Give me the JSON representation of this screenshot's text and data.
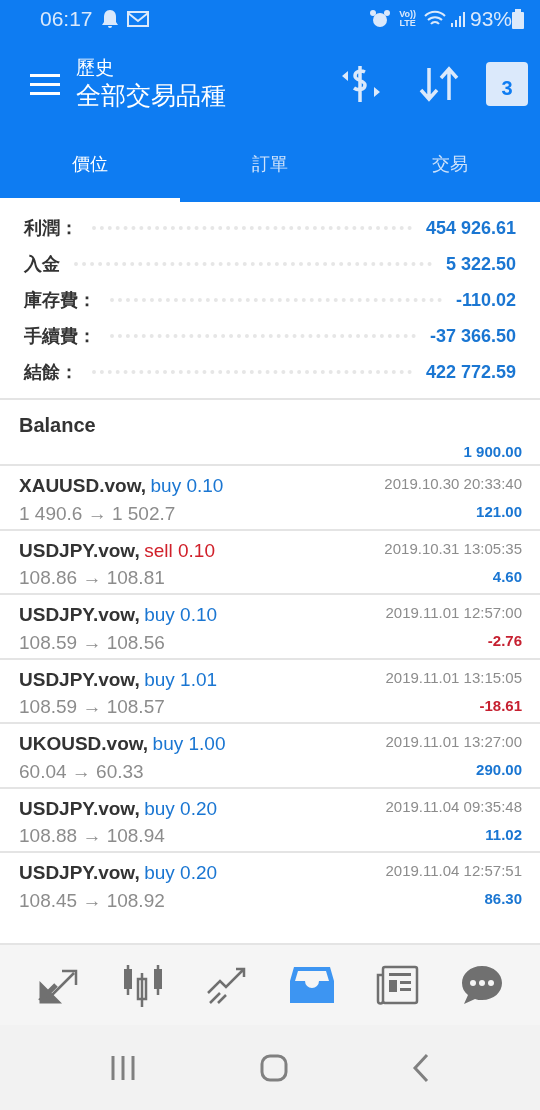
{
  "status_bar": {
    "time": "06:17",
    "volte_top": "Vo))",
    "volte_bottom": "LTE",
    "battery": "93%"
  },
  "header": {
    "subtitle": "歷史",
    "title": "全部交易品種",
    "calendar_day": "3"
  },
  "tabs": [
    {
      "label": "價位",
      "selected": true
    },
    {
      "label": "訂單",
      "selected": false
    },
    {
      "label": "交易",
      "selected": false
    }
  ],
  "summary": [
    {
      "label": "利潤：",
      "value": "454 926.61"
    },
    {
      "label": "入金",
      "value": "5 322.50"
    },
    {
      "label": "庫存費：",
      "value": "-110.02"
    },
    {
      "label": "手續費：",
      "value": "-37 366.50"
    },
    {
      "label": "結餘：",
      "value": "422 772.59"
    }
  ],
  "balance": {
    "label": "Balance",
    "amount": "1 900.00"
  },
  "trades": [
    {
      "symbol": "XAUUSD.vow,",
      "kind": "buy",
      "side": "buy 0.10",
      "prices": "1 490.6 → 1 502.7",
      "time": "2019.10.30 20:33:40",
      "profit": "121.00",
      "loss": false
    },
    {
      "symbol": "USDJPY.vow,",
      "kind": "sell",
      "side": "sell 0.10",
      "prices": "108.86 → 108.81",
      "time": "2019.10.31 13:05:35",
      "profit": "4.60",
      "loss": false
    },
    {
      "symbol": "USDJPY.vow,",
      "kind": "buy",
      "side": "buy 0.10",
      "prices": "108.59 → 108.56",
      "time": "2019.11.01 12:57:00",
      "profit": "-2.76",
      "loss": true
    },
    {
      "symbol": "USDJPY.vow,",
      "kind": "buy",
      "side": "buy 1.01",
      "prices": "108.59 → 108.57",
      "time": "2019.11.01 13:15:05",
      "profit": "-18.61",
      "loss": true
    },
    {
      "symbol": "UKOUSD.vow,",
      "kind": "buy",
      "side": "buy 1.00",
      "prices": "60.04 → 60.33",
      "time": "2019.11.01 13:27:00",
      "profit": "290.00",
      "loss": false
    },
    {
      "symbol": "USDJPY.vow,",
      "kind": "buy",
      "side": "buy 0.20",
      "prices": "108.88 → 108.94",
      "time": "2019.11.04 09:35:48",
      "profit": "11.02",
      "loss": false
    },
    {
      "symbol": "USDJPY.vow,",
      "kind": "buy",
      "side": "buy 0.20",
      "prices": "108.45 → 108.92",
      "time": "2019.11.04 12:57:51",
      "profit": "86.30",
      "loss": false
    }
  ],
  "bottom_nav": [
    {
      "kind": "quotes",
      "selected": false
    },
    {
      "kind": "chart",
      "selected": false
    },
    {
      "kind": "trade",
      "selected": false
    },
    {
      "kind": "history",
      "selected": true
    },
    {
      "kind": "news",
      "selected": false
    },
    {
      "kind": "chat",
      "selected": false
    }
  ]
}
